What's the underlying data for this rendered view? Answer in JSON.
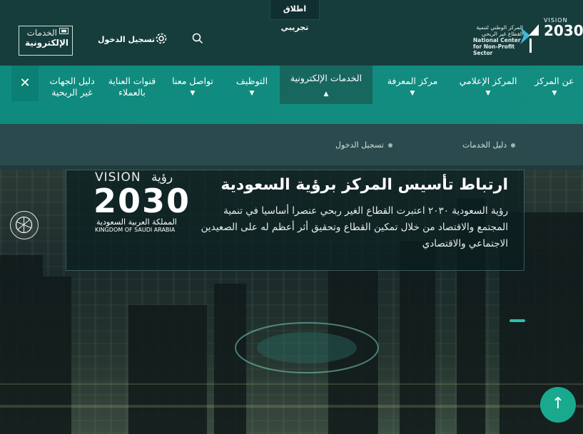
{
  "header": {
    "beta_label": "اطلاق تجريبي",
    "eservices_logo": {
      "line1": "الخدمات",
      "line2": "الإلكترونية"
    },
    "login_label": "تسجيل الدخول",
    "org_logo": {
      "arabic": "المركز الوطني لتنمية القطاع غير الربحي",
      "english": "National Center for Non-Profit Sector"
    },
    "vision_logo": {
      "top": "VISION",
      "year": "2030"
    }
  },
  "nav": {
    "items": [
      {
        "label": "عن المركز",
        "has_chevron": true
      },
      {
        "label": "المركز الإعلامي",
        "has_chevron": true
      },
      {
        "label": "مركز المعرفة",
        "has_chevron": true
      },
      {
        "label": "الخدمات الإلكترونية",
        "has_chevron": true,
        "active": true
      },
      {
        "label": "التوظيف",
        "has_chevron": true
      },
      {
        "label": "تواصل معنا",
        "has_chevron": true
      },
      {
        "label": "قنوات العناية بالعملاء",
        "has_chevron": false
      },
      {
        "label": "دليل الجهات غير الربحية",
        "has_chevron": false
      }
    ],
    "close_icon": "close-icon"
  },
  "subnav": {
    "items": [
      {
        "label": "دليل الخدمات"
      },
      {
        "label": "تسجيل الدخول"
      }
    ]
  },
  "hero": {
    "title": "ارتباط تأسيس المركز برؤية السعودية",
    "body": "رؤية السعودية ٢٠٣٠ اعتبرت القطاع الغير ربحي عنصرا أساسيا في تنمية المجتمع والاقتصاد من خلال تمكين القطاع وتحقيق أثر أعظم له على الصعيدين الاجتماعي والاقتصادي",
    "vision_badge": {
      "vision_word": "VISION",
      "arabic_word": "رؤية",
      "year": "2030",
      "kingdom_ar": "المملكة العربية السعودية",
      "kingdom_en": "KINGDOM OF SAUDI ARABIA"
    }
  },
  "colors": {
    "header_bg": "#163d3c",
    "nav_bg": "#0f8a7e",
    "nav_active": "#17675f",
    "accent": "#19a98f"
  }
}
